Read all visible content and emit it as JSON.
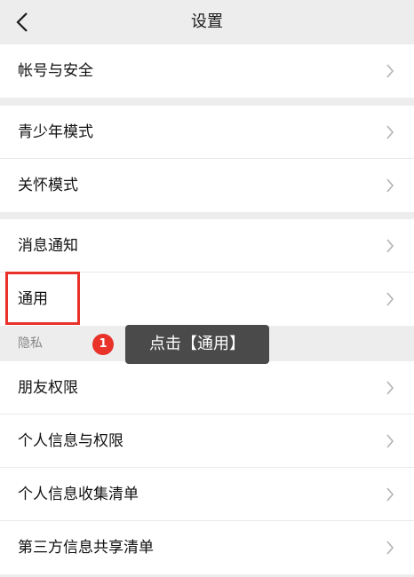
{
  "header": {
    "title": "设置",
    "back_icon": "chevron-left-icon"
  },
  "groups": [
    {
      "items": [
        {
          "label": "帐号与安全"
        }
      ]
    },
    {
      "items": [
        {
          "label": "青少年模式"
        },
        {
          "label": "关怀模式"
        }
      ]
    },
    {
      "items": [
        {
          "label": "消息通知"
        },
        {
          "label": "通用"
        }
      ]
    },
    {
      "header": "隐私",
      "items": [
        {
          "label": "朋友权限"
        },
        {
          "label": "个人信息与权限"
        },
        {
          "label": "个人信息收集清单"
        },
        {
          "label": "第三方信息共享清单"
        }
      ]
    }
  ],
  "annotation": {
    "step_number": "1",
    "tooltip_text": "点击【通用】",
    "highlight_color": "#e8322a"
  },
  "colors": {
    "background": "#ededed",
    "row_background": "#ffffff",
    "tooltip_background": "#4a4a4a"
  }
}
